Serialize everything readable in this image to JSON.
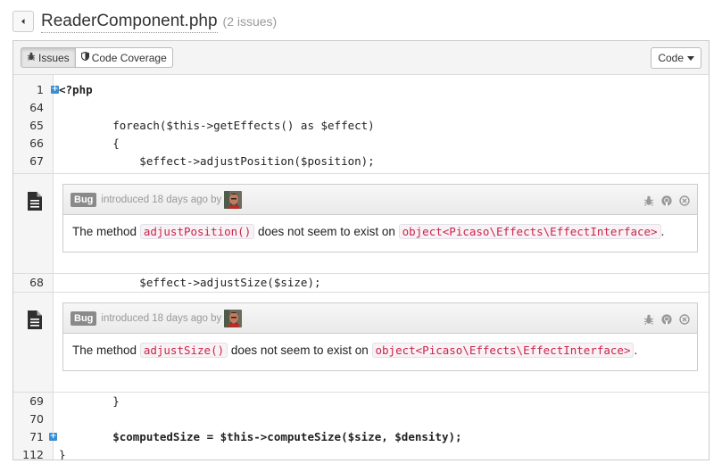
{
  "header": {
    "title": "ReaderComponent.php",
    "issue_count": "(2 issues)"
  },
  "toolbar": {
    "issues_label": "Issues",
    "coverage_label": "Code Coverage",
    "code_label": "Code"
  },
  "lines": [
    {
      "num": "1",
      "code": "<?php"
    },
    {
      "num": "64",
      "code": ""
    },
    {
      "num": "65",
      "code": "        foreach($this->getEffects() as $effect)"
    },
    {
      "num": "66",
      "code": "        {"
    },
    {
      "num": "67",
      "code": "            $effect->adjustPosition($position);"
    },
    {
      "num": "68",
      "code": "            $effect->adjustSize($size);"
    },
    {
      "num": "69",
      "code": "        }"
    },
    {
      "num": "70",
      "code": ""
    },
    {
      "num": "71",
      "code": "        $computedSize = $this->computeSize($size, $density);"
    },
    {
      "num": "112",
      "code": "}"
    }
  ],
  "issues": [
    {
      "label": "Bug",
      "meta_text": "introduced 18 days ago by",
      "msg_prefix": "The method",
      "method": "adjustPosition()",
      "msg_middle": "does not seem to exist on",
      "type": "object<Picaso\\Effects\\EffectInterface>",
      "msg_suffix": "."
    },
    {
      "label": "Bug",
      "meta_text": "introduced 18 days ago by",
      "msg_prefix": "The method",
      "method": "adjustSize()",
      "msg_middle": "does not seem to exist on",
      "type": "object<Picaso\\Effects\\EffectInterface>",
      "msg_suffix": "."
    }
  ],
  "colors": {
    "expand_button": "#3b8fd1",
    "code_highlight": "#c7254e",
    "bug_label": "#8a8a8a"
  }
}
